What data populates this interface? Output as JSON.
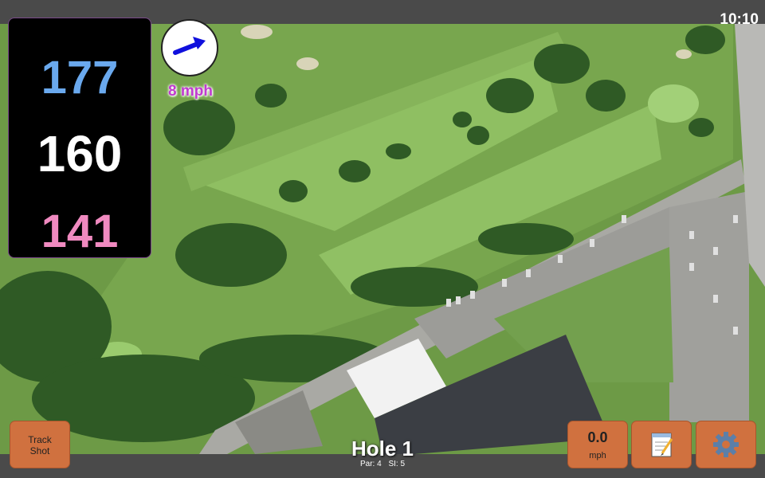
{
  "status_bar": {
    "time": "10:10"
  },
  "yardages": {
    "back": "177",
    "middle": "160",
    "front": "141"
  },
  "wind": {
    "speed_label": "8 mph",
    "icon": "arrow-icon"
  },
  "hole": {
    "title": "Hole 1",
    "par_label": "Par: 4",
    "si_label": "SI: 5"
  },
  "buttons": {
    "track_shot_line1": "Track",
    "track_shot_line2": "Shot",
    "speed_value": "0.0",
    "speed_unit": "mph",
    "notes_icon": "notepad-icon",
    "settings_icon": "gear-icon"
  },
  "colors": {
    "back_yardage": "#6aa9ee",
    "middle_yardage": "#ffffff",
    "front_yardage": "#f08ac0",
    "wind_text": "#c03ad0",
    "button_bg": "#d0713f"
  }
}
